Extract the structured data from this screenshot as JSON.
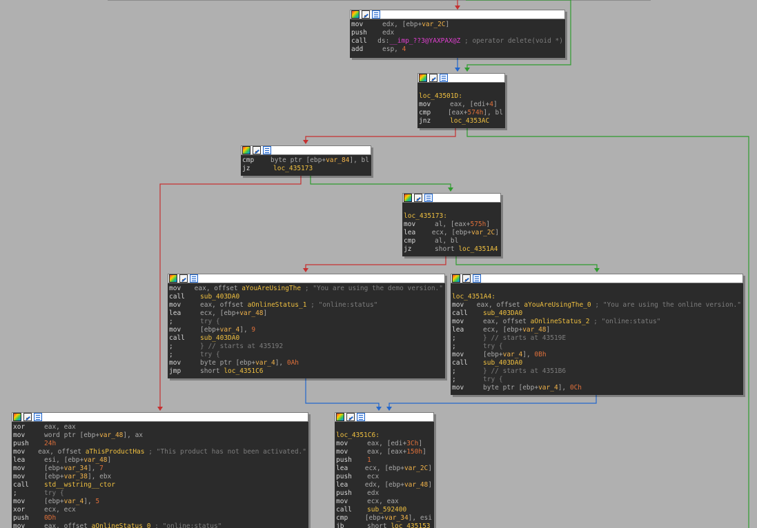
{
  "colors": {
    "background": "#b0b0b0",
    "node_bg": "#2b2b2b",
    "edge_true": "#2e9b2e",
    "edge_false": "#c53030",
    "edge_unconditional": "#2266cc"
  },
  "icons": [
    "color-palette-icon",
    "graph-overview-icon",
    "text-view-icon"
  ],
  "nodes": [
    {
      "label": "",
      "lines": [
        {
          "mn": "mov",
          "ops": [
            {
              "t": "op",
              "v": "edx, [ebp+"
            },
            {
              "t": "var",
              "v": "var_2C"
            },
            {
              "t": "op",
              "v": "]"
            }
          ]
        },
        {
          "mn": "push",
          "ops": [
            {
              "t": "op",
              "v": "edx"
            }
          ]
        },
        {
          "mn": "call",
          "ops": [
            {
              "t": "op",
              "v": "ds:"
            },
            {
              "t": "imp",
              "v": "__imp_??3@YAXPAX@Z"
            },
            {
              "t": "cmt",
              "v": " ; operator delete(void *)"
            }
          ]
        },
        {
          "mn": "add",
          "ops": [
            {
              "t": "op",
              "v": "esp, "
            },
            {
              "t": "num",
              "v": "4"
            }
          ]
        }
      ]
    },
    {
      "label": "loc_43501D:",
      "lines": [
        {
          "mn": "mov",
          "ops": [
            {
              "t": "op",
              "v": "eax, [edi+"
            },
            {
              "t": "num",
              "v": "4"
            },
            {
              "t": "op",
              "v": "]"
            }
          ]
        },
        {
          "mn": "cmp",
          "ops": [
            {
              "t": "op",
              "v": "[eax+"
            },
            {
              "t": "num",
              "v": "574h"
            },
            {
              "t": "op",
              "v": "], bl"
            }
          ]
        },
        {
          "mn": "jnz",
          "ops": [
            {
              "t": "name",
              "v": "loc_4353AC"
            }
          ]
        }
      ]
    },
    {
      "label": "",
      "lines": [
        {
          "mn": "cmp",
          "ops": [
            {
              "t": "op",
              "v": "byte ptr [ebp+"
            },
            {
              "t": "var",
              "v": "var_84"
            },
            {
              "t": "op",
              "v": "], bl"
            }
          ]
        },
        {
          "mn": "jz",
          "ops": [
            {
              "t": "name",
              "v": "loc_435173"
            }
          ]
        }
      ]
    },
    {
      "label": "loc_435173:",
      "lines": [
        {
          "mn": "mov",
          "ops": [
            {
              "t": "op",
              "v": "al, [eax+"
            },
            {
              "t": "num",
              "v": "575h"
            },
            {
              "t": "op",
              "v": "]"
            }
          ]
        },
        {
          "mn": "lea",
          "ops": [
            {
              "t": "op",
              "v": "ecx, [ebp+"
            },
            {
              "t": "var",
              "v": "var_2C"
            },
            {
              "t": "op",
              "v": "]"
            }
          ]
        },
        {
          "mn": "cmp",
          "ops": [
            {
              "t": "op",
              "v": "al, bl"
            }
          ]
        },
        {
          "mn": "jz",
          "ops": [
            {
              "t": "op",
              "v": "short "
            },
            {
              "t": "name",
              "v": "loc_4351A4"
            }
          ]
        }
      ]
    },
    {
      "label": "",
      "lines": [
        {
          "mn": "mov",
          "ops": [
            {
              "t": "op",
              "v": "eax, offset "
            },
            {
              "t": "name",
              "v": "aYouAreUsingThe"
            },
            {
              "t": "str",
              "v": " ; \"You are using the demo version.\""
            }
          ]
        },
        {
          "mn": "call",
          "ops": [
            {
              "t": "name",
              "v": "sub_403DA0"
            }
          ]
        },
        {
          "mn": "mov",
          "ops": [
            {
              "t": "op",
              "v": "eax, offset "
            },
            {
              "t": "name",
              "v": "aOnlineStatus_1"
            },
            {
              "t": "str",
              "v": " ; \"online:status\""
            }
          ]
        },
        {
          "mn": "lea",
          "ops": [
            {
              "t": "op",
              "v": "ecx, [ebp+"
            },
            {
              "t": "var",
              "v": "var_48"
            },
            {
              "t": "op",
              "v": "]"
            }
          ]
        },
        {
          "mn": ";",
          "ops": [
            {
              "t": "cmt",
              "v": "try {"
            }
          ]
        },
        {
          "mn": "mov",
          "ops": [
            {
              "t": "op",
              "v": "[ebp+"
            },
            {
              "t": "var",
              "v": "var_4"
            },
            {
              "t": "op",
              "v": "], "
            },
            {
              "t": "num",
              "v": "9"
            }
          ]
        },
        {
          "mn": "call",
          "ops": [
            {
              "t": "name",
              "v": "sub_403DA0"
            }
          ]
        },
        {
          "mn": ";",
          "ops": [
            {
              "t": "cmt",
              "v": "} // starts at 435192"
            }
          ]
        },
        {
          "mn": ";",
          "ops": [
            {
              "t": "cmt",
              "v": "try {"
            }
          ]
        },
        {
          "mn": "mov",
          "ops": [
            {
              "t": "op",
              "v": "byte ptr [ebp+"
            },
            {
              "t": "var",
              "v": "var_4"
            },
            {
              "t": "op",
              "v": "], "
            },
            {
              "t": "num",
              "v": "0Ah"
            }
          ]
        },
        {
          "mn": "jmp",
          "ops": [
            {
              "t": "op",
              "v": "short "
            },
            {
              "t": "name",
              "v": "loc_4351C6"
            }
          ]
        }
      ]
    },
    {
      "label": "loc_4351A4:",
      "lines": [
        {
          "mn": "mov",
          "ops": [
            {
              "t": "op",
              "v": "eax, offset "
            },
            {
              "t": "name",
              "v": "aYouAreUsingThe_0"
            },
            {
              "t": "str",
              "v": " ; \"You are using the online version.\""
            }
          ]
        },
        {
          "mn": "call",
          "ops": [
            {
              "t": "name",
              "v": "sub_403DA0"
            }
          ]
        },
        {
          "mn": "mov",
          "ops": [
            {
              "t": "op",
              "v": "eax, offset "
            },
            {
              "t": "name",
              "v": "aOnlineStatus_2"
            },
            {
              "t": "str",
              "v": " ; \"online:status\""
            }
          ]
        },
        {
          "mn": "lea",
          "ops": [
            {
              "t": "op",
              "v": "ecx, [ebp+"
            },
            {
              "t": "var",
              "v": "var_48"
            },
            {
              "t": "op",
              "v": "]"
            }
          ]
        },
        {
          "mn": ";",
          "ops": [
            {
              "t": "cmt",
              "v": "} // starts at 43519E"
            }
          ]
        },
        {
          "mn": ";",
          "ops": [
            {
              "t": "cmt",
              "v": "try {"
            }
          ]
        },
        {
          "mn": "mov",
          "ops": [
            {
              "t": "op",
              "v": "[ebp+"
            },
            {
              "t": "var",
              "v": "var_4"
            },
            {
              "t": "op",
              "v": "], "
            },
            {
              "t": "num",
              "v": "0Bh"
            }
          ]
        },
        {
          "mn": "call",
          "ops": [
            {
              "t": "name",
              "v": "sub_403DA0"
            }
          ]
        },
        {
          "mn": ";",
          "ops": [
            {
              "t": "cmt",
              "v": "} // starts at 4351B6"
            }
          ]
        },
        {
          "mn": ";",
          "ops": [
            {
              "t": "cmt",
              "v": "try {"
            }
          ]
        },
        {
          "mn": "mov",
          "ops": [
            {
              "t": "op",
              "v": "byte ptr [ebp+"
            },
            {
              "t": "var",
              "v": "var_4"
            },
            {
              "t": "op",
              "v": "], "
            },
            {
              "t": "num",
              "v": "0Ch"
            }
          ]
        }
      ]
    },
    {
      "label": "",
      "lines": [
        {
          "mn": "xor",
          "ops": [
            {
              "t": "op",
              "v": "eax, eax"
            }
          ]
        },
        {
          "mn": "mov",
          "ops": [
            {
              "t": "op",
              "v": "word ptr [ebp+"
            },
            {
              "t": "var",
              "v": "var_48"
            },
            {
              "t": "op",
              "v": "], ax"
            }
          ]
        },
        {
          "mn": "push",
          "ops": [
            {
              "t": "num",
              "v": "24h"
            }
          ]
        },
        {
          "mn": "mov",
          "ops": [
            {
              "t": "op",
              "v": "eax, offset "
            },
            {
              "t": "name",
              "v": "aThisProductHas"
            },
            {
              "t": "str",
              "v": " ; \"This product has not been activated.\""
            }
          ]
        },
        {
          "mn": "lea",
          "ops": [
            {
              "t": "op",
              "v": "esi, [ebp+"
            },
            {
              "t": "var",
              "v": "var_48"
            },
            {
              "t": "op",
              "v": "]"
            }
          ]
        },
        {
          "mn": "mov",
          "ops": [
            {
              "t": "op",
              "v": "[ebp+"
            },
            {
              "t": "var",
              "v": "var_34"
            },
            {
              "t": "op",
              "v": "], "
            },
            {
              "t": "num",
              "v": "7"
            }
          ]
        },
        {
          "mn": "mov",
          "ops": [
            {
              "t": "op",
              "v": "[ebp+"
            },
            {
              "t": "var",
              "v": "var_38"
            },
            {
              "t": "op",
              "v": "], ebx"
            }
          ]
        },
        {
          "mn": "call",
          "ops": [
            {
              "t": "name",
              "v": "std__wstring__ctor"
            }
          ]
        },
        {
          "mn": ";",
          "ops": [
            {
              "t": "cmt",
              "v": "try {"
            }
          ]
        },
        {
          "mn": "mov",
          "ops": [
            {
              "t": "op",
              "v": "[ebp+"
            },
            {
              "t": "var",
              "v": "var_4"
            },
            {
              "t": "op",
              "v": "], "
            },
            {
              "t": "num",
              "v": "5"
            }
          ]
        },
        {
          "mn": "xor",
          "ops": [
            {
              "t": "op",
              "v": "ecx, ecx"
            }
          ]
        },
        {
          "mn": "push",
          "ops": [
            {
              "t": "num",
              "v": "0Dh"
            }
          ]
        },
        {
          "mn": "mov",
          "ops": [
            {
              "t": "op",
              "v": "eax, offset "
            },
            {
              "t": "name",
              "v": "aOnlineStatus_0"
            },
            {
              "t": "str",
              "v": " ; \"online:status\""
            }
          ]
        }
      ]
    },
    {
      "label": "loc_4351C6:",
      "lines": [
        {
          "mn": "mov",
          "ops": [
            {
              "t": "op",
              "v": "eax, [edi+"
            },
            {
              "t": "num",
              "v": "3Ch"
            },
            {
              "t": "op",
              "v": "]"
            }
          ]
        },
        {
          "mn": "mov",
          "ops": [
            {
              "t": "op",
              "v": "eax, [eax+"
            },
            {
              "t": "num",
              "v": "150h"
            },
            {
              "t": "op",
              "v": "]"
            }
          ]
        },
        {
          "mn": "push",
          "ops": [
            {
              "t": "num",
              "v": "1"
            }
          ]
        },
        {
          "mn": "lea",
          "ops": [
            {
              "t": "op",
              "v": "ecx, [ebp+"
            },
            {
              "t": "var",
              "v": "var_2C"
            },
            {
              "t": "op",
              "v": "]"
            }
          ]
        },
        {
          "mn": "push",
          "ops": [
            {
              "t": "op",
              "v": "ecx"
            }
          ]
        },
        {
          "mn": "lea",
          "ops": [
            {
              "t": "op",
              "v": "edx, [ebp+"
            },
            {
              "t": "var",
              "v": "var_48"
            },
            {
              "t": "op",
              "v": "]"
            }
          ]
        },
        {
          "mn": "push",
          "ops": [
            {
              "t": "op",
              "v": "edx"
            }
          ]
        },
        {
          "mn": "mov",
          "ops": [
            {
              "t": "op",
              "v": "ecx, eax"
            }
          ]
        },
        {
          "mn": "call",
          "ops": [
            {
              "t": "name",
              "v": "sub_592400"
            }
          ]
        },
        {
          "mn": "cmp",
          "ops": [
            {
              "t": "op",
              "v": "[ebp+"
            },
            {
              "t": "var",
              "v": "var_34"
            },
            {
              "t": "op",
              "v": "], esi"
            }
          ]
        },
        {
          "mn": "jb",
          "ops": [
            {
              "t": "op",
              "v": "short "
            },
            {
              "t": "name",
              "v": "loc_435153"
            }
          ]
        }
      ]
    }
  ]
}
